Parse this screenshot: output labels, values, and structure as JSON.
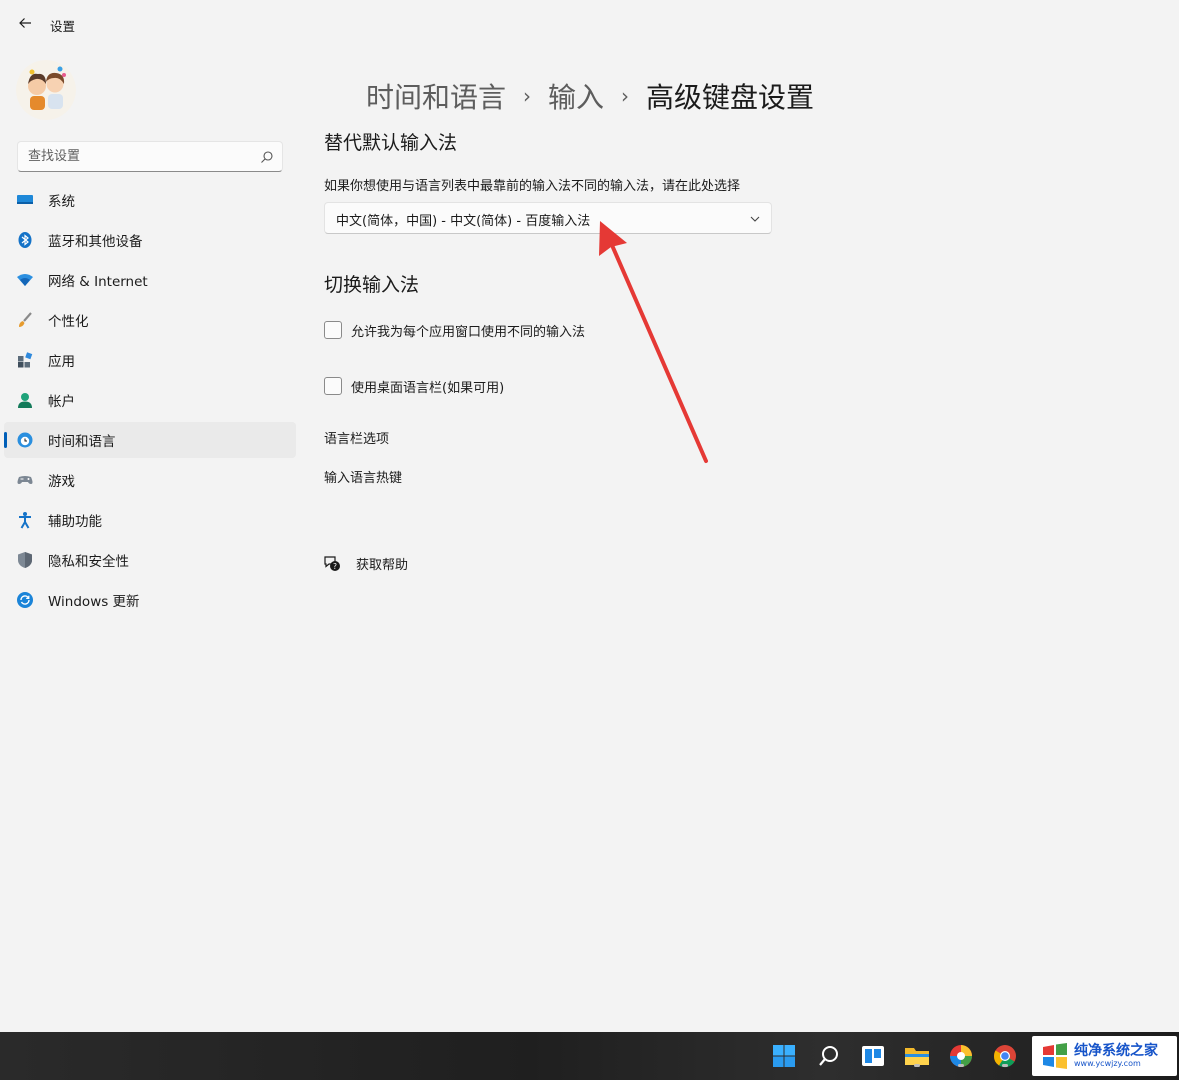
{
  "app": {
    "title": "设置"
  },
  "search": {
    "placeholder": "查找设置"
  },
  "sidebar": {
    "items": [
      {
        "label": "系统",
        "icon": "monitor-icon"
      },
      {
        "label": "蓝牙和其他设备",
        "icon": "bluetooth-icon"
      },
      {
        "label": "网络 & Internet",
        "icon": "wifi-icon"
      },
      {
        "label": "个性化",
        "icon": "brush-icon"
      },
      {
        "label": "应用",
        "icon": "apps-icon"
      },
      {
        "label": "帐户",
        "icon": "person-icon"
      },
      {
        "label": "时间和语言",
        "icon": "globe-clock-icon",
        "active": true
      },
      {
        "label": "游戏",
        "icon": "gamepad-icon"
      },
      {
        "label": "辅助功能",
        "icon": "accessibility-icon"
      },
      {
        "label": "隐私和安全性",
        "icon": "shield-icon"
      },
      {
        "label": "Windows 更新",
        "icon": "update-icon"
      }
    ]
  },
  "breadcrumb": {
    "part1": "时间和语言",
    "part2": "输入",
    "current": "高级键盘设置",
    "separator": "›"
  },
  "override": {
    "title": "替代默认输入法",
    "description": "如果你想使用与语言列表中最靠前的输入法不同的输入法，请在此处选择",
    "selected": "中文(简体，中国) - 中文(简体) - 百度输入法"
  },
  "switching": {
    "title": "切换输入法",
    "options": [
      {
        "label": "允许我为每个应用窗口使用不同的输入法",
        "checked": false
      },
      {
        "label": "使用桌面语言栏(如果可用)",
        "checked": false
      }
    ]
  },
  "links": {
    "language_bar": "语言栏选项",
    "hotkeys": "输入语言热键"
  },
  "help": {
    "label": "获取帮助"
  },
  "watermark": {
    "title": "纯净系统之家",
    "url": "www.ycwjzy.com"
  },
  "colors": {
    "accent": "#005fb8",
    "arrow": "#e53935"
  }
}
